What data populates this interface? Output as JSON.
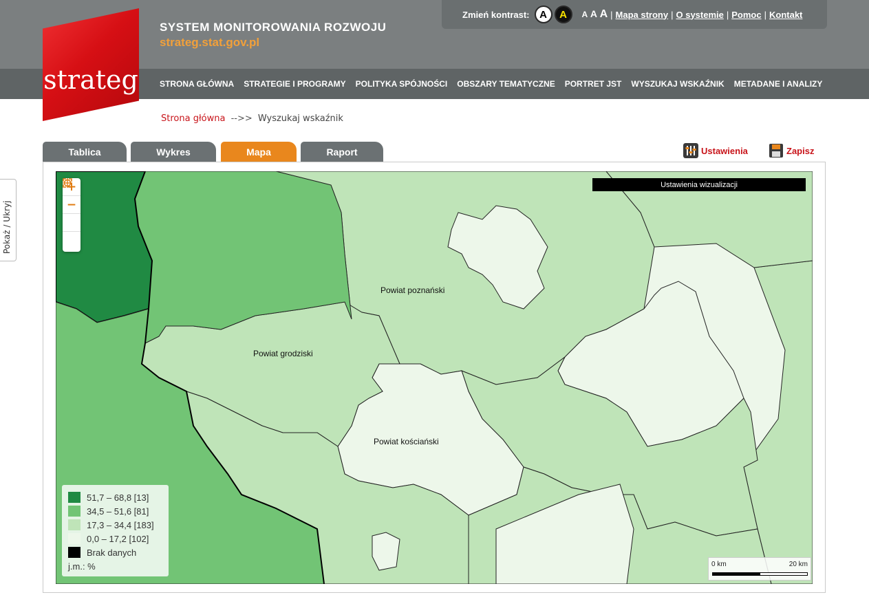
{
  "header": {
    "site_title": "SYSTEM MONITOROWANIA ROZWOJU",
    "site_url": "strateg.stat.gov.pl",
    "logo_text": "strateg",
    "brand_color": "#d60f14",
    "accent_color": "#f1a03a"
  },
  "utility": {
    "contrast_label": "Zmień kontrast:",
    "contrast_normal": "A",
    "contrast_high": "A",
    "font_small": "A",
    "font_medium": "A",
    "font_large": "A",
    "links": [
      "Mapa strony",
      "O systemie",
      "Pomoc",
      "Kontakt"
    ],
    "separator": "|"
  },
  "nav": {
    "items": [
      "STRONA GŁÓWNA",
      "STRATEGIE I PROGRAMY",
      "POLITYKA SPÓJNOŚCI",
      "OBSZARY TEMATYCZNE",
      "PORTRET JST",
      "WYSZUKAJ WSKAŹNIK",
      "METADANE I ANALIZY"
    ]
  },
  "breadcrumb": {
    "home": "Strona główna",
    "separator": "-->>",
    "current": "Wyszukaj wskaźnik"
  },
  "tabs": [
    {
      "label": "Tablica",
      "active": false
    },
    {
      "label": "Wykres",
      "active": false
    },
    {
      "label": "Mapa",
      "active": true
    },
    {
      "label": "Raport",
      "active": false
    }
  ],
  "actions": {
    "settings_label": "Ustawienia",
    "save_label": "Zapisz",
    "settings_icon": "sliders-icon",
    "save_icon": "floppy-disk-icon"
  },
  "side_toggle": {
    "label": "Pokaż / Ukryj"
  },
  "map": {
    "viz_settings_label": "Ustawienia wizualizacji",
    "zoom_in": "+",
    "zoom_out": "−",
    "locate_icon": "crosshair-icon",
    "fullscreen_icon": "expand-icon",
    "region_labels": {
      "poznanski": "Powiat poznański",
      "grodziski": "Powiat grodziski",
      "koscianski": "Powiat kościański"
    },
    "legend": {
      "items": [
        {
          "label": "51,7 – 68,8 [13]",
          "color": "#208a43"
        },
        {
          "label": "34,5 – 51,6 [81]",
          "color": "#72c475"
        },
        {
          "label": "17,3 – 34,4 [183]",
          "color": "#bfe4b8"
        },
        {
          "label": "0,0 – 17,2 [102]",
          "color": "#edf7ea"
        },
        {
          "label": "Brak danych",
          "color": "#000000"
        }
      ],
      "unit": "j.m.: %"
    },
    "scale": {
      "min_label": "0 km",
      "max_label": "20 km"
    }
  }
}
